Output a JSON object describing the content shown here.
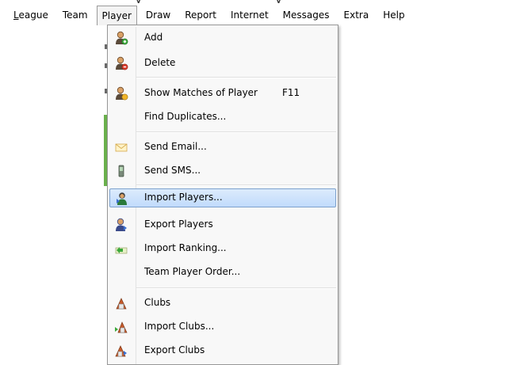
{
  "menubar": {
    "items": [
      {
        "label": "League",
        "mnemonic": "L",
        "rest": "eague",
        "active": false
      },
      {
        "label": "Team",
        "active": false
      },
      {
        "label": "Player",
        "active": true
      },
      {
        "label": "Draw",
        "active": false
      },
      {
        "label": "Report",
        "active": false
      },
      {
        "label": "Internet",
        "active": false
      },
      {
        "label": "Messages",
        "active": false
      },
      {
        "label": "Extra",
        "active": false
      },
      {
        "label": "Help",
        "active": false
      }
    ]
  },
  "dropdown": {
    "items": [
      {
        "label": "Add",
        "icon": "player-add-icon"
      },
      {
        "label": "Delete",
        "icon": "player-delete-icon"
      },
      {
        "label": "Show Matches of Player",
        "shortcut": "F11",
        "icon": "player-matches-icon"
      },
      {
        "label": "Find Duplicates...",
        "icon": null
      },
      {
        "label": "Send Email...",
        "icon": "envelope-icon"
      },
      {
        "label": "Send SMS...",
        "icon": "mobile-phone-icon"
      },
      {
        "label": "Import Players...",
        "icon": "import-players-icon",
        "highlighted": true
      },
      {
        "label": "Export Players",
        "icon": "export-players-icon"
      },
      {
        "label": "Import Ranking...",
        "icon": "import-ranking-icon"
      },
      {
        "label": "Team Player Order...",
        "icon": null
      },
      {
        "label": "Clubs",
        "icon": "clubs-icon"
      },
      {
        "label": "Import Clubs...",
        "icon": "import-clubs-icon"
      },
      {
        "label": "Export Clubs",
        "icon": "export-clubs-icon"
      }
    ]
  },
  "colors": {
    "highlight_top": "#dcebfc",
    "highlight_bottom": "#c1dbfc",
    "highlight_border": "#7da2ce",
    "menu_background": "#f8f8f8",
    "green_strip": "#6ab04c"
  }
}
